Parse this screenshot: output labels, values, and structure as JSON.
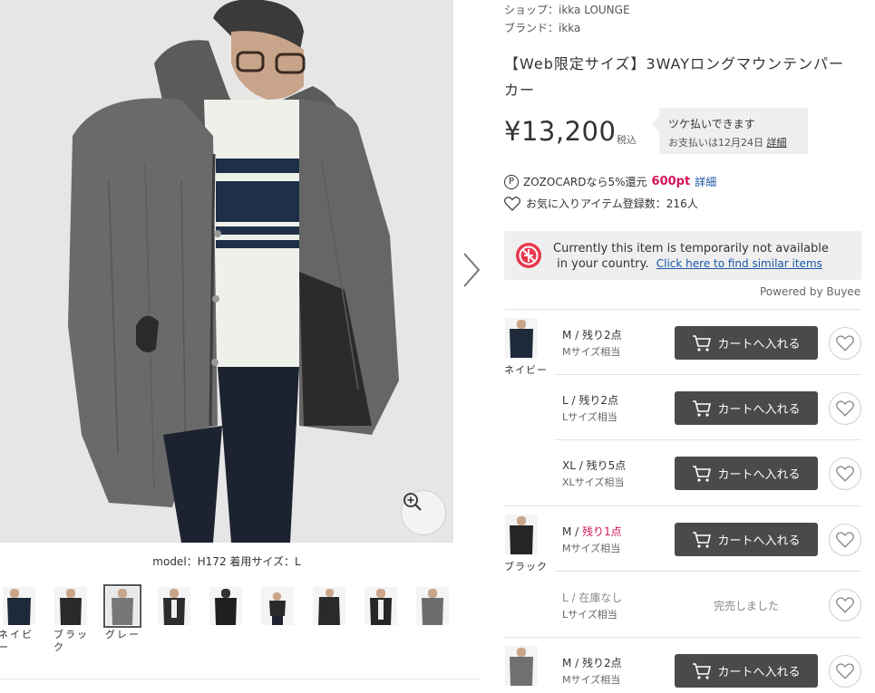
{
  "product": {
    "shop": "ショップ：ikka LOUNGE",
    "brand": "ブランド：ikka",
    "title": "【Web限定サイズ】3WAYロングマウンテンパーカー",
    "price": "¥13,200",
    "tax_label": "税込"
  },
  "tsuke": {
    "line1": "ツケ払いできます",
    "line2": "お支払いは12月24日",
    "link": "詳細"
  },
  "zozocard": {
    "text": "ZOZOCARDなら5%還元",
    "points": "600pt",
    "link": "詳細",
    "icon": "P"
  },
  "favorites": {
    "text": "お気に入りアイテム登録数：216人"
  },
  "buyee": {
    "line1": "Currently this item is temporarily not available",
    "line2": "in your country.",
    "link": "Click here to find similar items",
    "powered": "Powered by Buyee"
  },
  "gallery": {
    "caption": "model：H172 着用サイズ：L",
    "thumbnails": [
      {
        "label": "ネイビー"
      },
      {
        "label": "ブラック"
      },
      {
        "label": "グレー"
      },
      {
        "label": ""
      },
      {
        "label": ""
      },
      {
        "label": ""
      },
      {
        "label": ""
      },
      {
        "label": ""
      },
      {
        "label": ""
      }
    ]
  },
  "skus": {
    "colors": [
      {
        "name": "ネイビー"
      },
      {
        "name": "ブラック"
      }
    ],
    "rows": [
      {
        "size": "M / ",
        "stock": "残り2点",
        "sub": "Mサイズ相当",
        "cart": "カートへ入れる"
      },
      {
        "size": "L / ",
        "stock": "残り2点",
        "sub": "Lサイズ相当",
        "cart": "カートへ入れる"
      },
      {
        "size": "XL / ",
        "stock": "残り5点",
        "sub": "XLサイズ相当",
        "cart": "カートへ入れる"
      },
      {
        "size": "M / ",
        "stock": "残り1点",
        "sub": "Mサイズ相当",
        "cart": "カートへ入れる"
      },
      {
        "size": "L / ",
        "stock": "在庫なし",
        "sub": "Lサイズ相当",
        "soldout": "完売しました"
      },
      {
        "size": "M / ",
        "stock": "残り2点",
        "sub": "Mサイズ相当",
        "cart": "カートへ入れる"
      }
    ]
  },
  "colors": {
    "accent_red": "#d4145a",
    "link_blue": "#1a56a8",
    "button_dark": "#4a4a4a"
  }
}
